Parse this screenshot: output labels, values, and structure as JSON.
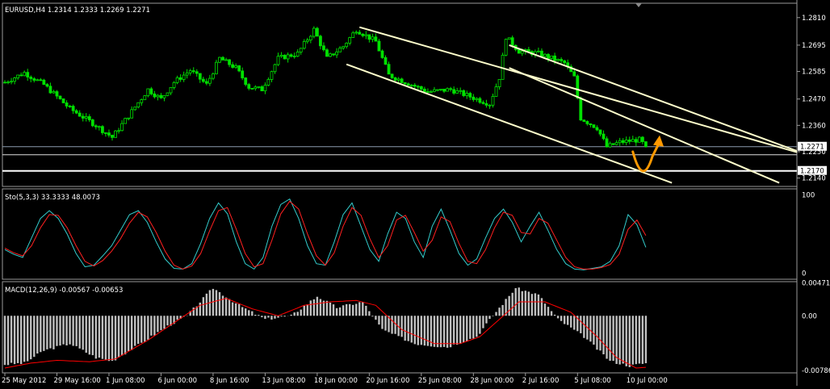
{
  "window": {
    "title": "EURUSD,H4",
    "ohlc": [
      "1.2314",
      "1.2333",
      "1.2269",
      "1.2271"
    ],
    "header_text": "EURUSD,H4  1.2314 1.2333 1.2269 1.2271"
  },
  "colors": {
    "background": "#000000",
    "grid": "#9a9a9a",
    "candles": "#00e000",
    "channel": "#ffffcc",
    "hline": "#ffffff",
    "stoch_main": "#33cccc",
    "stoch_signal": "#ff2020",
    "macd_hist": "#c0c0c0",
    "macd_signal": "#ff0000",
    "arrow": "#ff9900"
  },
  "icons": [
    "scroll-marker-icon",
    "forecast-arrow-icon"
  ],
  "chart_data": [
    {
      "type": "candlestick",
      "symbol": "EURUSD",
      "timeframe": "H4",
      "title": "EURUSD,H4  1.2314 1.2333 1.2269 1.2271",
      "ylim": [
        1.2105,
        1.287
      ],
      "y_ticks": [
        "1.2810",
        "1.2695",
        "1.2585",
        "1.2470",
        "1.2360",
        "1.2250",
        "1.2140"
      ],
      "x_ticks": [
        "25 May 2012",
        "29 May 16:00",
        "1 Jun 08:00",
        "6 Jun 00:00",
        "8 Jun 16:00",
        "13 Jun 08:00",
        "18 Jun 00:00",
        "20 Jun 16:00",
        "25 Jun 08:00",
        "28 Jun 00:00",
        "2 Jul 16:00",
        "5 Jul 08:00",
        "10 Jul 00:00"
      ],
      "x_tick_bars": [
        0,
        16,
        32,
        48,
        64,
        80,
        96,
        112,
        128,
        144,
        160,
        176,
        192
      ],
      "bar_count": 198,
      "close_path": [
        [
          0,
          1.254
        ],
        [
          6,
          1.258
        ],
        [
          12,
          1.253
        ],
        [
          20,
          1.243
        ],
        [
          28,
          1.236
        ],
        [
          33,
          1.231
        ],
        [
          38,
          1.24
        ],
        [
          44,
          1.251
        ],
        [
          48,
          1.247
        ],
        [
          52,
          1.254
        ],
        [
          57,
          1.259
        ],
        [
          62,
          1.253
        ],
        [
          66,
          1.264
        ],
        [
          71,
          1.26
        ],
        [
          75,
          1.252
        ],
        [
          79,
          1.251
        ],
        [
          84,
          1.264
        ],
        [
          90,
          1.266
        ],
        [
          95,
          1.276
        ],
        [
          99,
          1.264
        ],
        [
          104,
          1.269
        ],
        [
          108,
          1.276
        ],
        [
          114,
          1.271
        ],
        [
          118,
          1.257
        ],
        [
          125,
          1.253
        ],
        [
          130,
          1.25
        ],
        [
          137,
          1.251
        ],
        [
          145,
          1.247
        ],
        [
          149,
          1.245
        ],
        [
          152,
          1.256
        ],
        [
          154,
          1.273
        ],
        [
          158,
          1.267
        ],
        [
          164,
          1.266
        ],
        [
          168,
          1.264
        ],
        [
          172,
          1.262
        ],
        [
          175,
          1.256
        ],
        [
          177,
          1.239
        ],
        [
          182,
          1.235
        ],
        [
          185,
          1.227
        ],
        [
          189,
          1.229
        ],
        [
          195,
          1.23
        ],
        [
          197,
          1.2271
        ]
      ],
      "last_price": 1.2271,
      "last_price_label": "1.2271",
      "support_level": 1.217,
      "support_label": "1.2170",
      "channel_lines": [
        {
          "name": "first-channel-upper",
          "x": [
            109,
            248
          ],
          "y": [
            1.277,
            1.223
          ]
        },
        {
          "name": "first-channel-lower",
          "x": [
            105,
            205
          ],
          "y": [
            1.2615,
            1.212
          ]
        },
        {
          "name": "second-channel-upper",
          "x": [
            155,
            248
          ],
          "y": [
            1.2695,
            1.223
          ]
        },
        {
          "name": "second-channel-middle",
          "x": [
            155,
            238
          ],
          "y": [
            1.26,
            1.212
          ]
        }
      ],
      "forecast_arrow": {
        "x": [
          193,
          196,
          199,
          201
        ],
        "y": [
          1.225,
          1.216,
          1.223,
          1.2305
        ]
      }
    },
    {
      "type": "line",
      "title": "Sto(5,3,3) 33.3333 48.0073",
      "ylim": [
        -8,
        108
      ],
      "y_ticks": [
        "100",
        "0"
      ],
      "series": [
        {
          "name": "main",
          "values": [
            30,
            24,
            20,
            45,
            70,
            80,
            70,
            50,
            25,
            8,
            10,
            22,
            35,
            55,
            75,
            80,
            65,
            40,
            18,
            6,
            5,
            12,
            38,
            70,
            90,
            76,
            40,
            12,
            5,
            20,
            60,
            88,
            95,
            70,
            35,
            12,
            10,
            40,
            75,
            90,
            60,
            30,
            15,
            50,
            78,
            70,
            40,
            20,
            60,
            82,
            55,
            25,
            10,
            18,
            45,
            70,
            82,
            65,
            40,
            60,
            78,
            55,
            30,
            12,
            5,
            4,
            6,
            8,
            15,
            35,
            75,
            62,
            33
          ]
        },
        {
          "name": "signal",
          "values": [
            32,
            26,
            22,
            35,
            58,
            75,
            74,
            58,
            35,
            15,
            9,
            16,
            28,
            44,
            64,
            78,
            72,
            52,
            28,
            10,
            5,
            9,
            25,
            54,
            80,
            84,
            56,
            25,
            8,
            12,
            42,
            76,
            92,
            82,
            50,
            22,
            10,
            26,
            60,
            84,
            74,
            44,
            20,
            35,
            68,
            74,
            52,
            28,
            42,
            72,
            66,
            38,
            15,
            12,
            30,
            58,
            78,
            74,
            52,
            50,
            70,
            64,
            42,
            20,
            8,
            5,
            5,
            7,
            11,
            24,
            56,
            68,
            48
          ]
        }
      ]
    },
    {
      "type": "bar",
      "title": "MACD(12,26,9) -0.00567 -0.00653",
      "ylim": [
        -0.0082,
        0.0049
      ],
      "y_ticks": [
        "0.00471",
        "0.00",
        "-0.00786"
      ],
      "y_tick_values": [
        0.00471,
        0.0,
        -0.00786
      ],
      "hist_path": [
        [
          0,
          -0.007
        ],
        [
          6,
          -0.0068
        ],
        [
          12,
          -0.005
        ],
        [
          20,
          -0.004
        ],
        [
          28,
          -0.006
        ],
        [
          33,
          -0.0065
        ],
        [
          40,
          -0.0045
        ],
        [
          50,
          -0.0015
        ],
        [
          56,
          0.0
        ],
        [
          64,
          0.004
        ],
        [
          72,
          0.0015
        ],
        [
          80,
          -0.0005
        ],
        [
          88,
          0.0
        ],
        [
          96,
          0.0028
        ],
        [
          102,
          0.0012
        ],
        [
          110,
          0.002
        ],
        [
          116,
          -0.002
        ],
        [
          126,
          -0.004
        ],
        [
          136,
          -0.0045
        ],
        [
          145,
          -0.003
        ],
        [
          150,
          0.0
        ],
        [
          157,
          0.004
        ],
        [
          164,
          0.003
        ],
        [
          170,
          -0.0005
        ],
        [
          178,
          -0.003
        ],
        [
          186,
          -0.0065
        ],
        [
          192,
          -0.0072
        ],
        [
          197,
          -0.0068
        ]
      ],
      "signal_path": [
        [
          0,
          -0.0075
        ],
        [
          8,
          -0.0068
        ],
        [
          16,
          -0.0064
        ],
        [
          26,
          -0.0066
        ],
        [
          34,
          -0.0062
        ],
        [
          44,
          -0.0035
        ],
        [
          52,
          -0.001
        ],
        [
          60,
          0.0015
        ],
        [
          68,
          0.0025
        ],
        [
          76,
          0.001
        ],
        [
          84,
          0.0
        ],
        [
          92,
          0.0015
        ],
        [
          100,
          0.002
        ],
        [
          108,
          0.0022
        ],
        [
          114,
          0.0015
        ],
        [
          122,
          -0.002
        ],
        [
          132,
          -0.004
        ],
        [
          140,
          -0.004
        ],
        [
          146,
          -0.003
        ],
        [
          152,
          -0.0005
        ],
        [
          158,
          0.002
        ],
        [
          166,
          0.002
        ],
        [
          174,
          0.0005
        ],
        [
          182,
          -0.003
        ],
        [
          188,
          -0.006
        ],
        [
          194,
          -0.0075
        ],
        [
          197,
          -0.0074
        ]
      ]
    }
  ]
}
